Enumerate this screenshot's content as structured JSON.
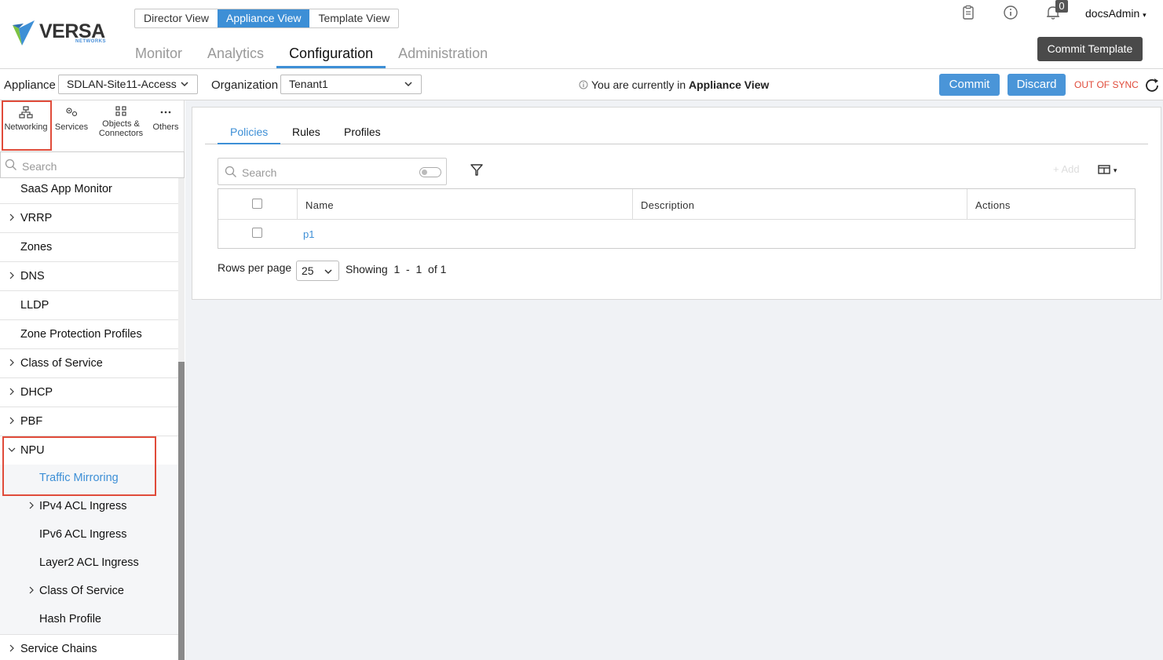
{
  "header": {
    "logo_text": "VERSA",
    "logo_sub": "NETWORKS",
    "view_switch": [
      "Director View",
      "Appliance View",
      "Template View"
    ],
    "active_view": "Appliance View",
    "nav": [
      "Monitor",
      "Analytics",
      "Configuration",
      "Administration"
    ],
    "active_nav": "Configuration",
    "notification_count": "0",
    "user": "docsAdmin",
    "commit_template_label": "Commit Template"
  },
  "toolbar": {
    "appliance_label": "Appliance",
    "appliance_value": "SDLAN-Site11-Access",
    "organization_label": "Organization",
    "organization_value": "Tenant1",
    "info_prefix": "You are currently in ",
    "info_view": "Appliance View",
    "commit_label": "Commit",
    "discard_label": "Discard",
    "sync_status": "OUT OF SYNC"
  },
  "left": {
    "categories": [
      "Networking",
      "Services",
      "Objects &",
      "Connectors",
      "Others"
    ],
    "search_placeholder": "Search",
    "tree": {
      "saas": "SaaS App Monitor",
      "vrrp": "VRRP",
      "zones": "Zones",
      "dns": "DNS",
      "lldp": "LLDP",
      "zpp": "Zone Protection Profiles",
      "cos": "Class of Service",
      "dhcp": "DHCP",
      "pbf": "PBF",
      "npu": "NPU",
      "npu_children": [
        "Traffic Mirroring",
        "IPv4 ACL Ingress",
        "IPv6 ACL Ingress",
        "Layer2 ACL Ingress",
        "Class Of Service",
        "Hash Profile"
      ],
      "service_chains": "Service Chains"
    }
  },
  "main": {
    "tabs": [
      "Policies",
      "Rules",
      "Profiles"
    ],
    "active_tab": "Policies",
    "search_placeholder": "Search",
    "add_label": "+ Add",
    "columns": [
      "Name",
      "Description",
      "Actions"
    ],
    "rows": [
      {
        "name": "p1",
        "description": "",
        "actions": ""
      }
    ],
    "rows_per_page_label": "Rows per page",
    "rows_per_page_value": "25",
    "showing_text": "Showing  1  -  1  of 1"
  },
  "colors": {
    "accent": "#3d8fd6",
    "highlight": "#e04b3a",
    "dark_button": "#4a4a4a"
  }
}
